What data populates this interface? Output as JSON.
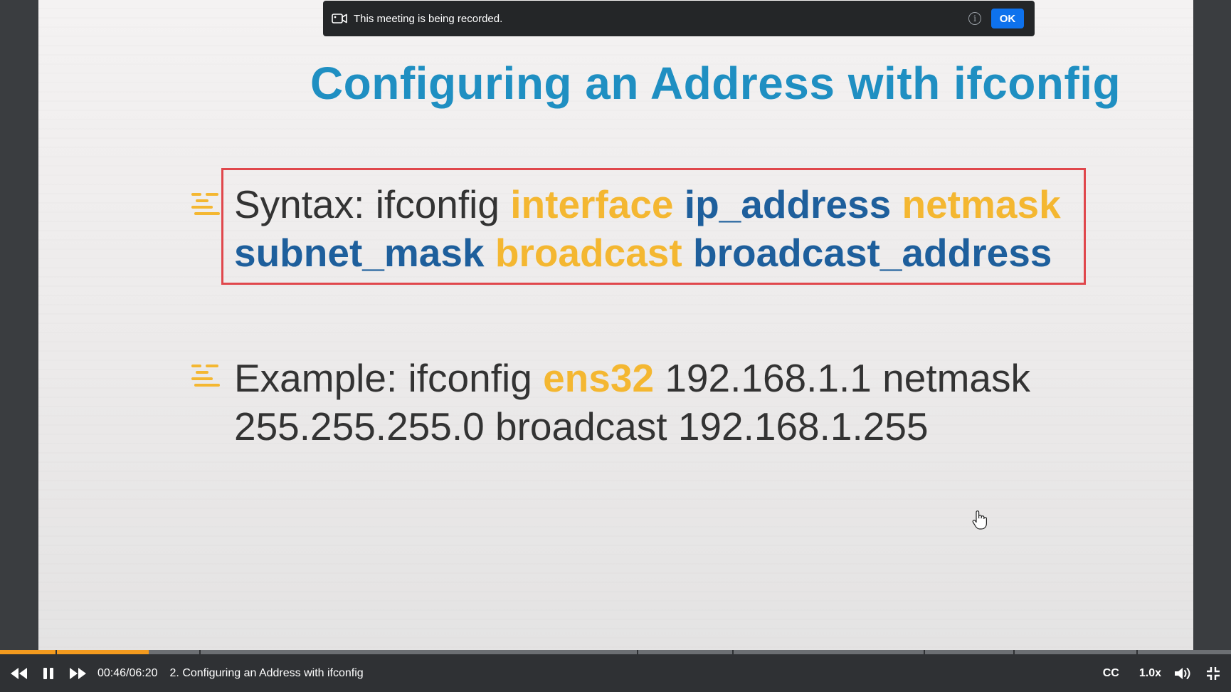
{
  "slide": {
    "title": "Configuring an Address with ifconfig",
    "syntax": {
      "lead": "Syntax: ifconfig",
      "interface": "interface",
      "ip_address": "ip_address",
      "netmask": "netmask",
      "subnet_mask": "subnet_mask",
      "broadcast": "broadcast",
      "broadcast_address": "broadcast_address"
    },
    "example": {
      "lead": "Example: ifconfig",
      "iface": "ens32",
      "rest_line1": "192.168.1.1 netmask",
      "line2": "255.255.255.0 broadcast 192.168.1.255"
    }
  },
  "recording_banner": {
    "text": "This meeting is being recorded.",
    "ok_label": "OK"
  },
  "player": {
    "time": "00:46/06:20",
    "title": "2. Configuring an Address with ifconfig",
    "cc_label": "CC",
    "speed_label": "1.0x",
    "progress": 0.121,
    "buffered": 0.11
  },
  "colors": {
    "accent": "#f39a1e",
    "title_blue": "#1f8fc2",
    "keyword_yellow": "#f4b731",
    "keyword_blue": "#1e5f9c",
    "highlight_red": "#e0474c",
    "ok_blue": "#0e72ed"
  },
  "icons": {
    "bullet": "bullet-lines-icon",
    "recording": "video-camera-icon",
    "info": "info-icon",
    "rewind": "rewind-icon",
    "pause": "pause-icon",
    "forward": "fast-forward-icon",
    "volume": "volume-icon",
    "fullscreen": "exit-fullscreen-icon",
    "cursor": "hand-cursor-icon"
  }
}
